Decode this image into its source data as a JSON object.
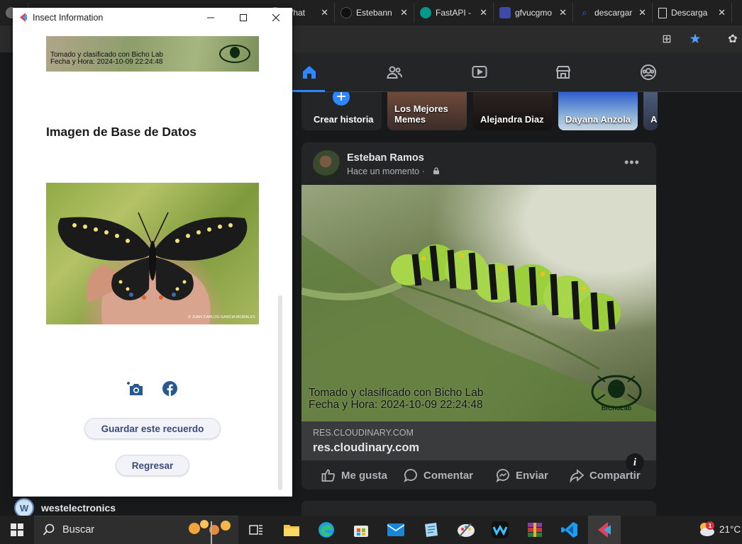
{
  "browser": {
    "tabs": [
      {
        "title": "",
        "favicon": "profile-avatar",
        "color": "#6b6b6b"
      },
      {
        "title": "What",
        "favicon": "whatsapp-icon",
        "color": "#25d366"
      },
      {
        "title": "Estebann",
        "favicon": "github-icon",
        "color": "#1b1b1b"
      },
      {
        "title": "FastAPI -",
        "favicon": "fastapi-icon",
        "color": "#05998b"
      },
      {
        "title": "gfvucgmo",
        "favicon": "cloud-drive-icon",
        "color": "#3d4aa8"
      },
      {
        "title": "descargar",
        "favicon": "search-icon",
        "color": "#1a73e8"
      },
      {
        "title": "Descarga",
        "favicon": "document-icon",
        "color": "#dddddd"
      }
    ]
  },
  "facebook": {
    "stories": [
      {
        "label": "Crear historia"
      },
      {
        "label": "Los Mejores Memes"
      },
      {
        "label": "Alejandra Diaz"
      },
      {
        "label": "Dayana Anzola"
      },
      {
        "label": "A"
      }
    ],
    "post": {
      "author": "Esteban Ramos",
      "time": "Hace un momento ·",
      "photo_caption_line1": "Tomado y clasificado con Bicho Lab",
      "photo_caption_line2": "Fecha y Hora: 2024-10-09 22:24:48",
      "watermark": "BiChoLab",
      "link_domain": "RES.CLOUDINARY.COM",
      "link_title": "res.cloudinary.com",
      "actions": {
        "like": "Me gusta",
        "comment": "Comentar",
        "send": "Enviar",
        "share": "Compartir"
      }
    },
    "suggestion": {
      "name": "westelectronics",
      "avatar_letter": "W"
    },
    "accent": "#2d88ff"
  },
  "app": {
    "window_title": "Insect Information",
    "banner_line1": "Tomado y clasificado con Bicho Lab",
    "banner_line2": "Fecha y Hora: 2024-10-09 22:24:48",
    "db_heading": "Imagen de Base de Datos",
    "photo_credit": "© JUAN CARLOS GARCIA MORALES",
    "save_button": "Guardar este recuerdo",
    "back_button": "Regresar",
    "button_text_color": "#3b4a78"
  },
  "taskbar": {
    "search_placeholder": "Buscar",
    "weather_badge": "1",
    "temperature": "21°C"
  }
}
